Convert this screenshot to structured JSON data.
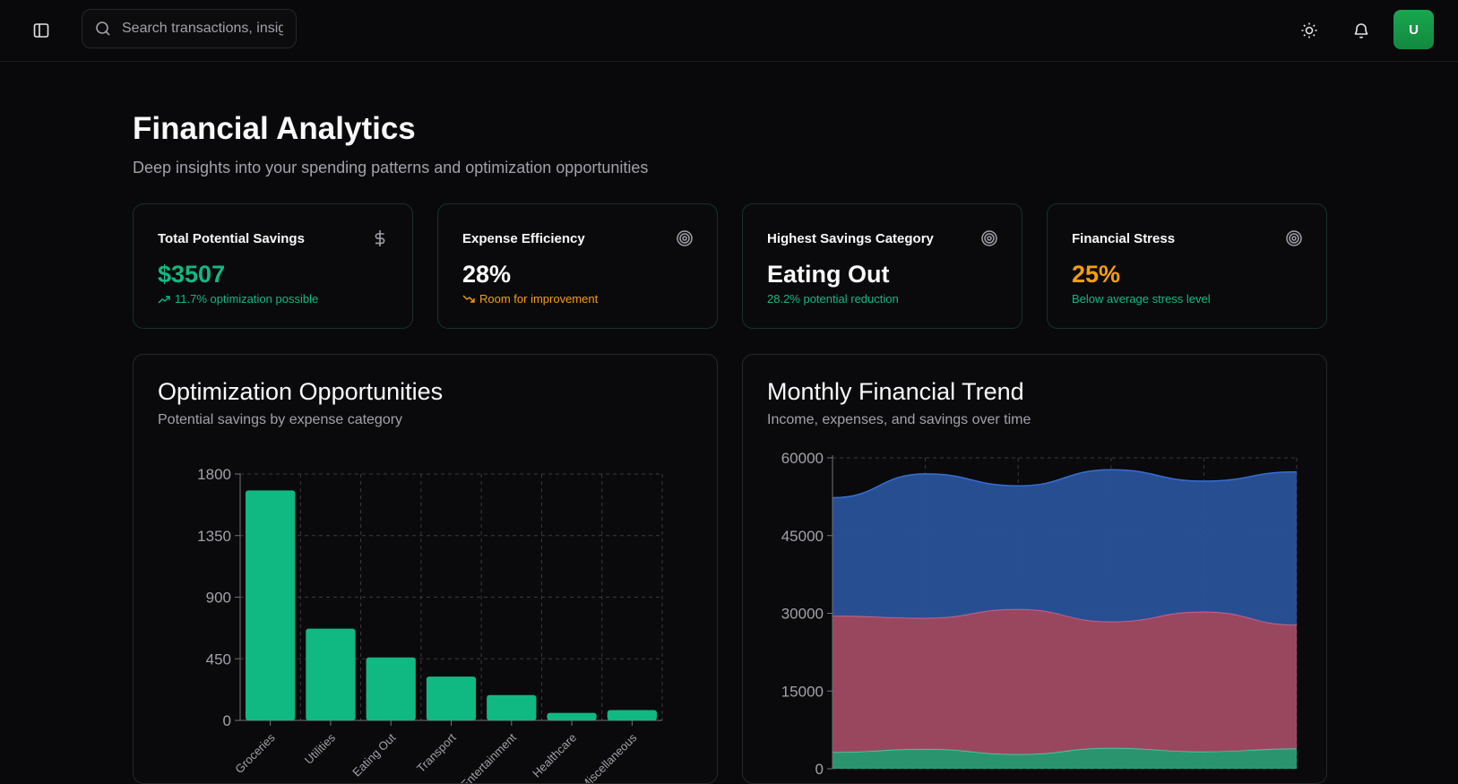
{
  "header": {
    "search_placeholder": "Search transactions, insights...",
    "avatar_initial": "U"
  },
  "page": {
    "title": "Financial Analytics",
    "subtitle": "Deep insights into your spending patterns and optimization opportunities"
  },
  "stats": [
    {
      "label": "Total Potential Savings",
      "value": "$3507",
      "sub": "11.7% optimization possible",
      "icon": "dollar-icon",
      "value_color": "#10b981",
      "sub_color": "#10b981",
      "sub_icon": "trending-up-icon"
    },
    {
      "label": "Expense Efficiency",
      "value": "28%",
      "sub": "Room for improvement",
      "icon": "target-icon",
      "value_color": "#fafafa",
      "sub_color": "#f59e0b",
      "sub_icon": "trending-down-icon"
    },
    {
      "label": "Highest Savings Category",
      "value": "Eating Out",
      "sub": "28.2% potential reduction",
      "icon": "target-icon",
      "value_color": "#fafafa",
      "sub_color": "#10b981",
      "sub_icon": ""
    },
    {
      "label": "Financial Stress",
      "value": "25%",
      "sub": "Below average stress level",
      "icon": "target-icon",
      "value_color": "#f59e0b",
      "sub_color": "#10b981",
      "sub_icon": ""
    }
  ],
  "panels": {
    "optimization": {
      "title": "Optimization Opportunities",
      "subtitle": "Potential savings by expense category"
    },
    "trend": {
      "title": "Monthly Financial Trend",
      "subtitle": "Income, expenses, and savings over time"
    }
  },
  "chart_data": [
    {
      "type": "bar",
      "categories": [
        "Groceries",
        "Utilities",
        "Eating Out",
        "Transport",
        "Entertainment",
        "Healthcare",
        "Miscellaneous"
      ],
      "values": [
        1680,
        670,
        460,
        320,
        185,
        55,
        75
      ],
      "yticks": [
        0,
        450,
        900,
        1350,
        1800
      ],
      "ylim": [
        0,
        1800
      ],
      "color": "#10b981",
      "grid": true
    },
    {
      "type": "area",
      "stacked": true,
      "x_count": 6,
      "series": [
        {
          "key": "savings",
          "values": [
            3200,
            3800,
            2800,
            4000,
            3300,
            3900
          ],
          "color": "#2da37a"
        },
        {
          "key": "expenses",
          "values": [
            26300,
            25300,
            28000,
            24400,
            27000,
            23900
          ],
          "color": "#a84d68"
        },
        {
          "key": "income",
          "values": [
            22800,
            27800,
            23800,
            29300,
            25200,
            29500
          ],
          "color": "#2a55a0"
        }
      ],
      "yticks": [
        0,
        15000,
        30000,
        45000,
        60000
      ],
      "ylim": [
        0,
        60000
      ],
      "grid": true
    }
  ]
}
